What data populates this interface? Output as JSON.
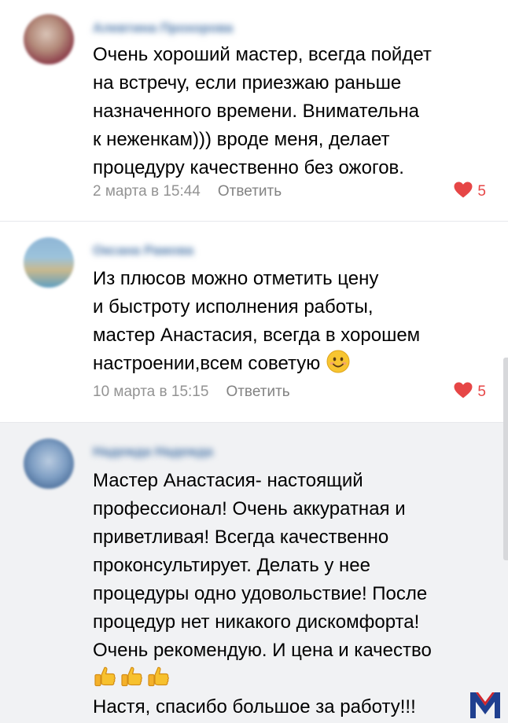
{
  "comments": [
    {
      "author": "Алевтина Прохорова",
      "lines": [
        "Очень хороший мастер, всегда пойдет",
        "на встречу, если приезжаю раньше",
        "назначенного времени. Внимательна",
        "к неженкам))) вроде меня, делает",
        "процедуру качественно без ожогов."
      ],
      "date": "2 марта в 15:44",
      "reply": "Ответить",
      "likes": "5"
    },
    {
      "author": "Оксана Рамова",
      "lines": [
        "Из плюсов можно отметить цену",
        "и быстроту исполнения работы,",
        "мастер Анастасия, всегда в хорошем",
        "настроении,всем советую"
      ],
      "date": "10 марта в 15:15",
      "reply": "Ответить",
      "likes": "5"
    },
    {
      "author": "Надежда Надежда",
      "lines": [
        "Мастер Анастасия- настоящий",
        "профессионал! Очень аккуратная и",
        "приветливая! Всегда качественно",
        "проконсультирует. Делать у нее",
        "процедуры одно удовольствие! После",
        "процедур нет никакого дискомфорта!",
        "Очень рекомендую. И цена и  качество"
      ],
      "closing": "Настя, спасибо большое за работу!!!"
    }
  ],
  "colors": {
    "author": "#4a76a8",
    "meta": "#939393",
    "like": "#e64646",
    "highlight_bg": "#f1f2f4",
    "watermark": "#1f3f8f"
  },
  "icons": {
    "like": "heart-icon",
    "smile": "smiling-face-emoji",
    "thumb": "thumbs-up-emoji",
    "watermark": "m-logo"
  }
}
